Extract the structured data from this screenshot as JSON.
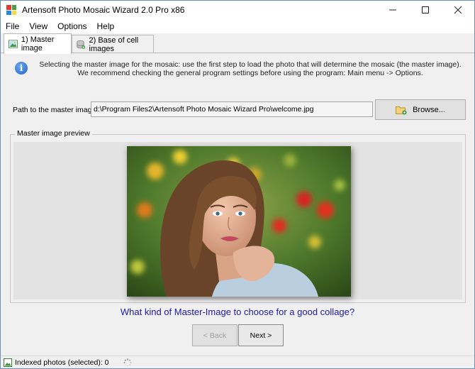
{
  "window": {
    "title": "Artensoft Photo Mosaic Wizard 2.0 Pro x86"
  },
  "menu": {
    "items": [
      "File",
      "View",
      "Options",
      "Help"
    ]
  },
  "tabs": [
    {
      "label": "1) Master image",
      "active": true,
      "icon": "picture-icon"
    },
    {
      "label": "2) Base of cell images",
      "active": false,
      "icon": "database-icon"
    }
  ],
  "info": {
    "text": "Selecting the master image for the mosaic: use the first step to load the photo that will determine the mosaic (the master image). We recommend checking the general program settings before using the program: Main menu -> Options."
  },
  "path": {
    "label": "Path to the master image:",
    "value": "d:\\Program Files2\\Artensoft Photo Mosaic Wizard Pro\\welcome.jpg",
    "browse_label": "Browse..."
  },
  "preview": {
    "legend": "Master image preview"
  },
  "question": "What kind of Master-Image to choose for a good collage?",
  "nav": {
    "back_label": "< Back",
    "next_label": "Next >"
  },
  "status": {
    "text": "Indexed photos (selected): 0"
  },
  "colors": {
    "accent_link": "#1a1aa8",
    "window_border": "#6e8fb8",
    "info_blue": "#1d62c4"
  }
}
